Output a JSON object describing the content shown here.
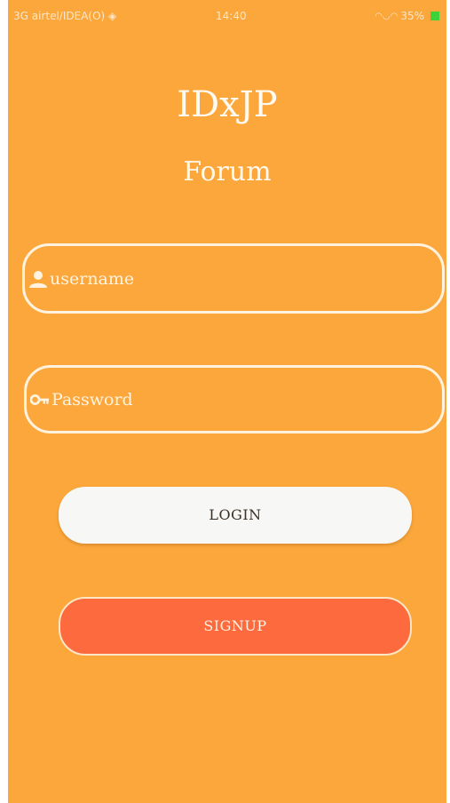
{
  "status_bar": {
    "carrier": "3G airtel/IDEA(O) ◈",
    "time": "14:40",
    "battery": "35%"
  },
  "app": {
    "title": "IDxJP",
    "subtitle": "Forum"
  },
  "login_form": {
    "username_placeholder": "username",
    "password_placeholder": "Password",
    "login_label": "LOGIN",
    "signup_label": "SIGNUP"
  },
  "colors": {
    "background": "#FBA73C",
    "login_button": "#F7F7F5",
    "signup_button": "#FC6A3E"
  },
  "icons": {
    "username": "user-icon",
    "password": "key-icon"
  }
}
